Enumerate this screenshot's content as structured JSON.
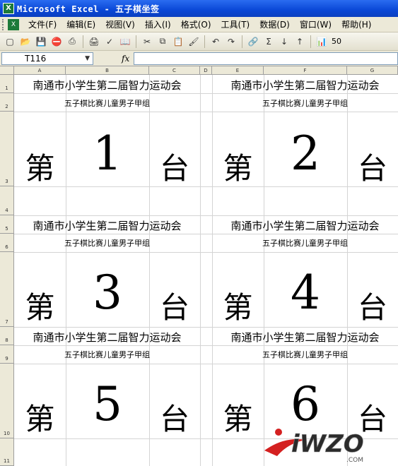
{
  "window": {
    "title": "Microsoft Excel - 五子棋坐签"
  },
  "menu": [
    "文件(F)",
    "编辑(E)",
    "视图(V)",
    "插入(I)",
    "格式(O)",
    "工具(T)",
    "数据(D)",
    "窗口(W)",
    "帮助(H)"
  ],
  "toolbar": {
    "icons": [
      "new-icon",
      "open-icon",
      "save-icon",
      "permission-icon",
      "print-icon",
      "print-preview-icon",
      "spelling-icon",
      "research-icon",
      "cut-icon",
      "copy-icon",
      "paste-icon",
      "format-painter-icon",
      "undo-icon",
      "redo-icon",
      "hyperlink-icon",
      "autosum-icon",
      "sort-ascending-icon",
      "sort-descending-icon",
      "chart-wizard-icon"
    ],
    "zoom": "50"
  },
  "formula_bar": {
    "name_box": "T116",
    "fx_label": "fx",
    "value": ""
  },
  "columns": [
    "A",
    "B",
    "C",
    "D",
    "E",
    "F",
    "G"
  ],
  "rows": [
    "1",
    "2",
    "3",
    "4",
    "5",
    "6",
    "7",
    "8",
    "9",
    "10",
    "11"
  ],
  "cards": [
    {
      "school": "南通市小学生第二届智力运动会",
      "group": "五子棋比赛儿童男子甲组",
      "di": "第",
      "num": "1",
      "tai": "台"
    },
    {
      "school": "南通市小学生第二届智力运动会",
      "group": "五子棋比赛儿童男子甲组",
      "di": "第",
      "num": "2",
      "tai": "台"
    },
    {
      "school": "南通市小学生第二届智力运动会",
      "group": "五子棋比赛儿童男子甲组",
      "di": "第",
      "num": "3",
      "tai": "台"
    },
    {
      "school": "南通市小学生第二届智力运动会",
      "group": "五子棋比赛儿童男子甲组",
      "di": "第",
      "num": "4",
      "tai": "台"
    },
    {
      "school": "南通市小学生第二届智力运动会",
      "group": "五子棋比赛儿童男子甲组",
      "di": "第",
      "num": "5",
      "tai": "台"
    },
    {
      "school": "南通市小学生第二届智力运动会",
      "group": "五子棋比赛儿童男子甲组",
      "di": "第",
      "num": "6",
      "tai": "台"
    }
  ],
  "watermark": {
    "logo": "iWZO",
    "sub": ".COM",
    "accent": "#d42020",
    "logo_color": "#2b2b2b"
  }
}
